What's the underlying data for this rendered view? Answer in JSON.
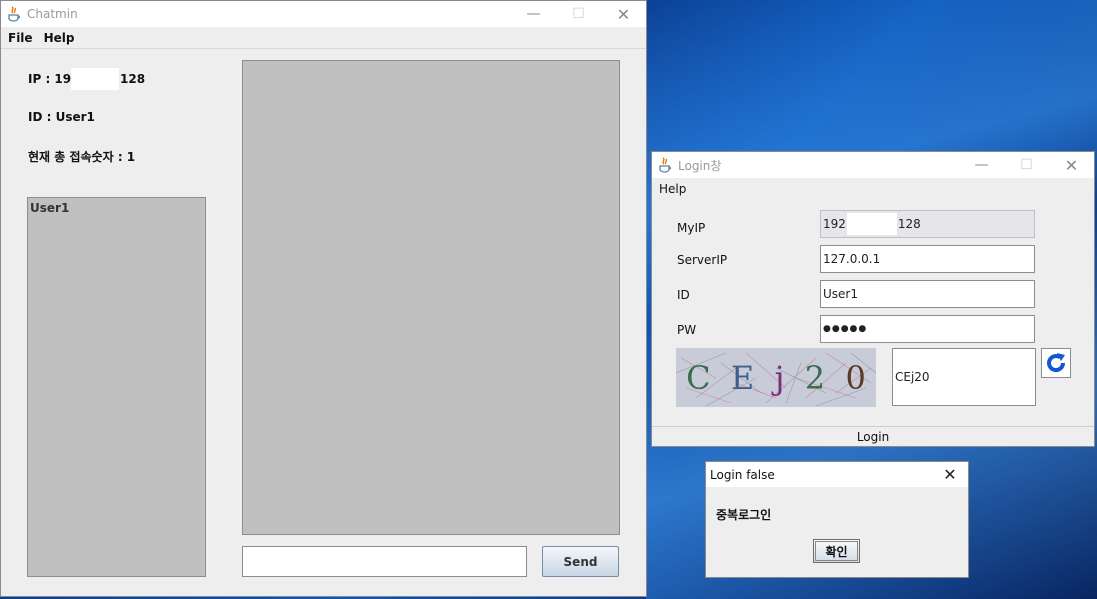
{
  "chat_window": {
    "title": "Chatmin",
    "menu": [
      "File",
      "Help"
    ],
    "ip_prefix": "IP : 192",
    "ip_suffix": "128",
    "id_text": "ID : User1",
    "count_text": "현재 총 접속숫자 : 1",
    "users": [
      "User1"
    ],
    "input_value": "",
    "send_label": "Send",
    "controls": {
      "minimize": "—",
      "maximize": "☐",
      "close": "✕"
    }
  },
  "login_window": {
    "title": "Login창",
    "menu": [
      "Help"
    ],
    "labels": {
      "myip": "MyIP",
      "serverip": "ServerIP",
      "id": "ID",
      "pw": "PW"
    },
    "values": {
      "myip_prefix": "192",
      "myip_suffix": "128",
      "serverip": "127.0.0.1",
      "id": "User1",
      "pw": "●●●●●",
      "captcha_input": "CEj20"
    },
    "captcha_chars": [
      "C",
      "E",
      "j",
      "2",
      "0"
    ],
    "captcha_colors": [
      "#3e6b4e",
      "#3f5f8a",
      "#7a2f7a",
      "#3e6b4e",
      "#5a3a2a"
    ],
    "login_label": "Login",
    "controls": {
      "minimize": "—",
      "maximize": "☐",
      "close": "✕"
    }
  },
  "dialog": {
    "title": "Login false",
    "message": "중복로그인",
    "ok_label": "확인",
    "close": "✕"
  }
}
